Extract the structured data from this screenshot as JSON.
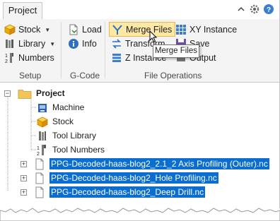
{
  "tab": {
    "label": "Project"
  },
  "ribbon": {
    "setup": {
      "label": "Setup",
      "stock": "Stock",
      "library": "Library",
      "numbers": "Numbers"
    },
    "gcode": {
      "label": "G-Code",
      "load": "Load",
      "info": "Info"
    },
    "file_ops": {
      "label": "File Operations",
      "merge_files": "Merge Files",
      "transform": "Transform",
      "z_instance": "Z Instance",
      "xy_instance": "XY Instance",
      "save": "Save",
      "output": "Output"
    }
  },
  "tooltip": {
    "text": "Merge Files"
  },
  "tree": {
    "root": "Project",
    "items": [
      {
        "label": "Machine",
        "icon": "machine-icon"
      },
      {
        "label": "Stock",
        "icon": "stock-cube-icon"
      },
      {
        "label": "Tool Library",
        "icon": "tool-library-icon"
      },
      {
        "label": "Tool Numbers",
        "icon": "tool-numbers-icon"
      }
    ],
    "files": [
      {
        "label": "PPG-Decoded-haas-blog2_2.1_2 Axis Profiling (Outer).nc"
      },
      {
        "label": "PPG-Decoded-haas-blog2_Hole Profiling.nc"
      },
      {
        "label": "PPG-Decoded-haas-blog2_Deep Drill.nc"
      }
    ]
  },
  "colors": {
    "selection": "#0a6ed1",
    "ribbon_bg": "#f4f4f4",
    "merge_highlight": "#fde8a5"
  }
}
